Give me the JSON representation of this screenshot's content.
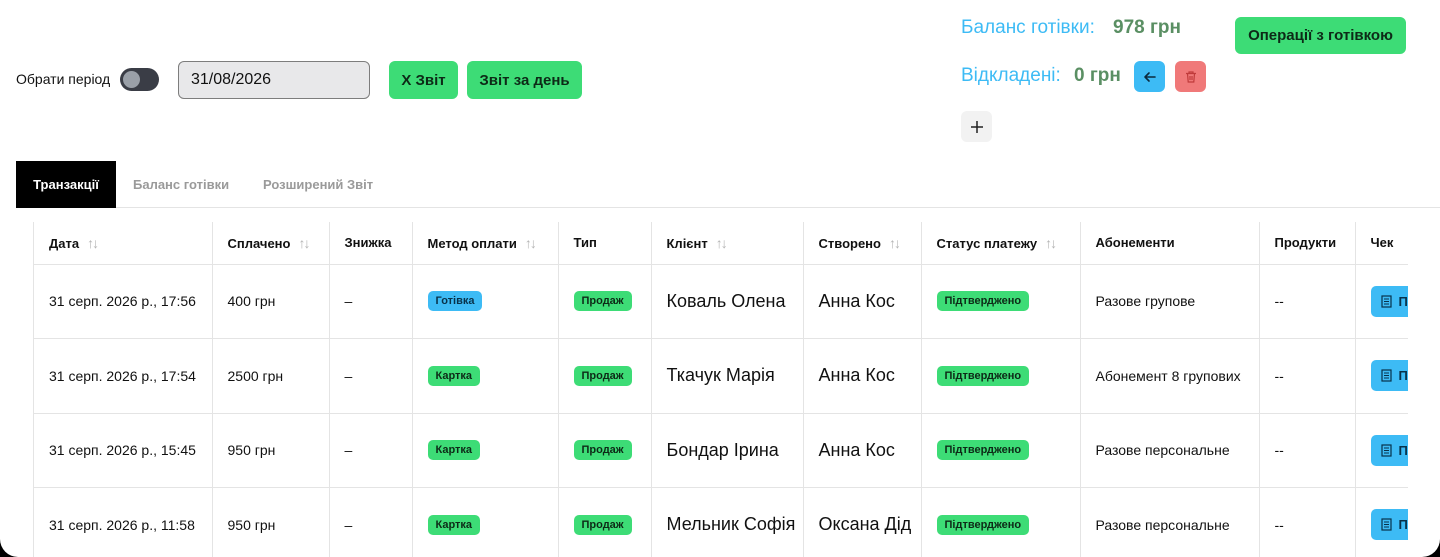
{
  "controls": {
    "period_label": "Обрати період",
    "date_value": "31/08/2026",
    "x_report": "X Звіт",
    "day_report": "Звіт за день",
    "cash_ops": "Операції з готівкою"
  },
  "balance": {
    "cash_label": "Баланс готівки:",
    "cash_value": "978 грн",
    "deferred_label": "Відкладені:",
    "deferred_value": "0 грн"
  },
  "tabs": [
    {
      "label": "Транзакції",
      "active": true
    },
    {
      "label": "Баланс готівки",
      "active": false
    },
    {
      "label": "Розширений Звіт",
      "active": false
    }
  ],
  "table": {
    "headers": [
      "Дата",
      "Сплачено",
      "Знижка",
      "Метод оплати",
      "Тип",
      "Клієнт",
      "Створено",
      "Статус платежу",
      "Абонементи",
      "Продукти",
      "Чек"
    ],
    "rows": [
      {
        "date": "31 серп. 2026 р., 17:56",
        "paid": "400 грн",
        "discount": "–",
        "method": "Готівка",
        "type": "Продаж",
        "client": "Коваль Олена",
        "created": "Анна Кос",
        "status": "Підтверджено",
        "subscription": "Разове групове",
        "products": "--",
        "cheque": "П"
      },
      {
        "date": "31 серп. 2026 р., 17:54",
        "paid": "2500 грн",
        "discount": "–",
        "method": "Картка",
        "type": "Продаж",
        "client": "Ткачук Марія",
        "created": "Анна Кос",
        "status": "Підтверджено",
        "subscription": "Абонемент 8 групових",
        "products": "--",
        "cheque": "П"
      },
      {
        "date": "31 серп. 2026 р., 15:45",
        "paid": "950 грн",
        "discount": "–",
        "method": "Картка",
        "type": "Продаж",
        "client": "Бондар Ірина",
        "created": "Анна Кос",
        "status": "Підтверджено",
        "subscription": "Разове персональне",
        "products": "--",
        "cheque": "П"
      },
      {
        "date": "31 серп. 2026 р., 11:58",
        "paid": "950 грн",
        "discount": "–",
        "method": "Картка",
        "type": "Продаж",
        "client": "Мельник Софія",
        "created": "Оксана Дід",
        "status": "Підтверджено",
        "subscription": "Разове персональне",
        "products": "--",
        "cheque": "П"
      }
    ]
  },
  "icons": {
    "back": "arrow-left-icon",
    "delete": "trash-icon",
    "add": "plus-icon",
    "sort": "sort-icon",
    "cheque": "receipt-icon"
  },
  "colors": {
    "accent_blue": "#3dbbf5",
    "accent_green": "#3ddc76",
    "danger": "#f07979",
    "balance_value": "#5a8f63"
  }
}
